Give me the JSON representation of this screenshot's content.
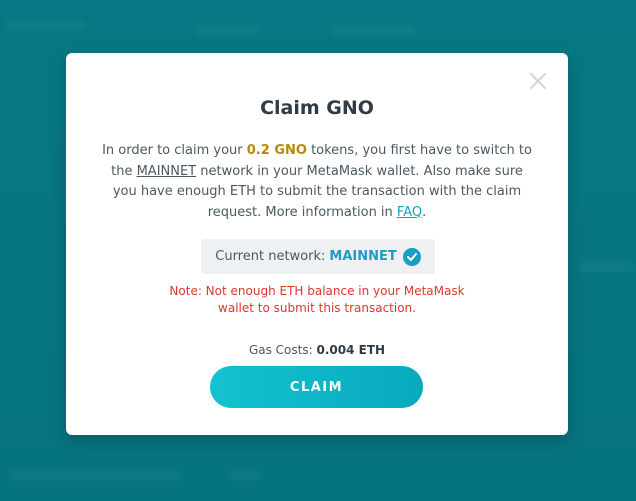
{
  "modal": {
    "title": "Claim GNO",
    "description": {
      "part1": "In order to claim your ",
      "amount": "0.2 GNO",
      "part2": " tokens, you first have to switch to the ",
      "network_link": "MAINNET",
      "part3": " network in your MetaMask wallet. Also make sure you have enough ETH to submit the transaction with the claim request. More information in ",
      "faq_link": "FAQ",
      "part4": "."
    },
    "network": {
      "label": "Current network:",
      "value": "MAINNET"
    },
    "note": "Note: Not enough ETH balance in your MetaMask wallet to submit this transaction.",
    "gas": {
      "label": "Gas Costs:",
      "value": "0.004 ETH"
    },
    "claim_label": "CLAIM"
  },
  "colors": {
    "accent": "#1a9ec3",
    "gno": "#b48a08",
    "error": "#e0372b",
    "background": "#0b7f89"
  },
  "icons": {
    "close": "close-icon",
    "check": "check-circle-icon"
  }
}
